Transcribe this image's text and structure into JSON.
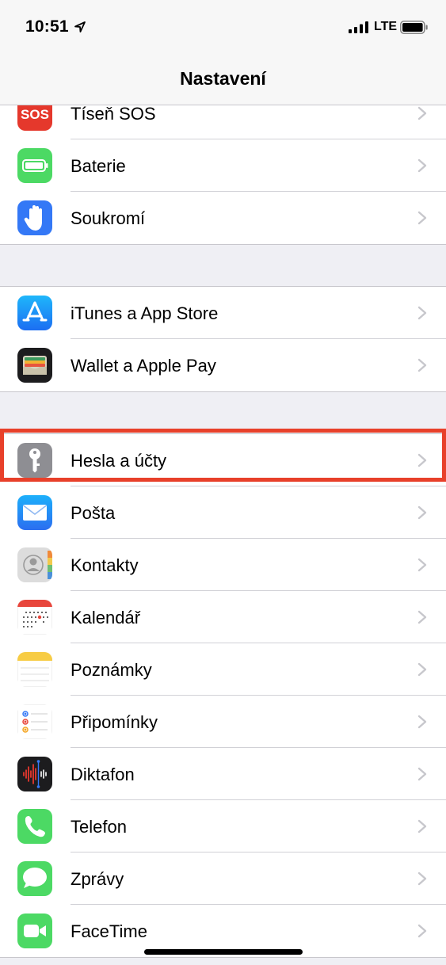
{
  "status": {
    "time": "10:51",
    "network": "LTE"
  },
  "nav": {
    "title": "Nastavení"
  },
  "groups": [
    {
      "items": [
        {
          "label": "Tíseň SOS",
          "icon": "sos-icon",
          "color": "#e5382c",
          "icon_text": "SOS"
        },
        {
          "label": "Baterie",
          "icon": "battery-icon",
          "color": "#4cd964"
        },
        {
          "label": "Soukromí",
          "icon": "hand-icon",
          "color": "#3478f6"
        }
      ]
    },
    {
      "items": [
        {
          "label": "iTunes a App Store",
          "icon": "app-store-icon",
          "color": "#1e8cf9"
        },
        {
          "label": "Wallet a Apple Pay",
          "icon": "wallet-icon",
          "color": "#1c1c1e"
        }
      ]
    },
    {
      "items": [
        {
          "label": "Hesla a účty",
          "icon": "key-icon",
          "color": "#8e8e93",
          "highlighted": true
        },
        {
          "label": "Pošta",
          "icon": "mail-icon",
          "color": "#2f7cf6"
        },
        {
          "label": "Kontakty",
          "icon": "contacts-icon",
          "color": "#d9d9d9"
        },
        {
          "label": "Kalendář",
          "icon": "calendar-icon",
          "color": "#ffffff"
        },
        {
          "label": "Poznámky",
          "icon": "notes-icon",
          "color": "#ffffff"
        },
        {
          "label": "Připomínky",
          "icon": "reminders-icon",
          "color": "#ffffff"
        },
        {
          "label": "Diktafon",
          "icon": "voice-memo-icon",
          "color": "#1c1c1e"
        },
        {
          "label": "Telefon",
          "icon": "phone-icon",
          "color": "#4cd964"
        },
        {
          "label": "Zprávy",
          "icon": "messages-icon",
          "color": "#4cd964"
        },
        {
          "label": "FaceTime",
          "icon": "facetime-icon",
          "color": "#4cd964"
        }
      ]
    }
  ],
  "colors": {
    "highlight": "#e8402a",
    "background": "#efeff4"
  }
}
